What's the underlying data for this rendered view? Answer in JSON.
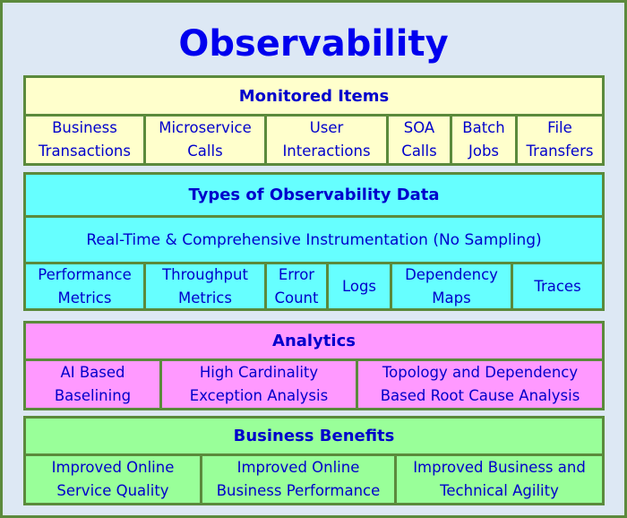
{
  "title": "Observability",
  "monitored": {
    "header": "Monitored Items",
    "items": [
      {
        "line1": "Business",
        "line2": "Transactions"
      },
      {
        "line1": "Microservice",
        "line2": "Calls"
      },
      {
        "line1": "User",
        "line2": "Interactions"
      },
      {
        "line1": "SOA",
        "line2": "Calls"
      },
      {
        "line1": "Batch",
        "line2": "Jobs"
      },
      {
        "line1": "File",
        "line2": "Transfers"
      }
    ]
  },
  "data_types": {
    "header": "Types of Observability Data",
    "subheader": "Real-Time & Comprehensive Instrumentation (No Sampling)",
    "items": [
      {
        "line1": "Performance",
        "line2": "Metrics"
      },
      {
        "line1": "Throughput",
        "line2": "Metrics"
      },
      {
        "line1": "Error",
        "line2": "Count"
      },
      {
        "line1": "Logs",
        "line2": ""
      },
      {
        "line1": "Dependency",
        "line2": "Maps"
      },
      {
        "line1": "Traces",
        "line2": ""
      }
    ]
  },
  "analytics": {
    "header": "Analytics",
    "items": [
      {
        "line1": "AI Based",
        "line2": "Baselining"
      },
      {
        "line1": "High Cardinality",
        "line2": "Exception Analysis"
      },
      {
        "line1": "Topology and Dependency",
        "line2": "Based Root Cause Analysis"
      }
    ]
  },
  "benefits": {
    "header": "Business Benefits",
    "items": [
      {
        "line1": "Improved Online",
        "line2": "Service Quality"
      },
      {
        "line1": "Improved Online",
        "line2": "Business Performance"
      },
      {
        "line1": "Improved Business and",
        "line2": "Technical Agility"
      }
    ]
  },
  "colors": {
    "border": "#5b8a3c",
    "background": "#dde8f4",
    "text": "#0000cc",
    "monitored": "#ffffcc",
    "data_types": "#66ffff",
    "analytics": "#ff99ff",
    "benefits": "#99ff99"
  }
}
